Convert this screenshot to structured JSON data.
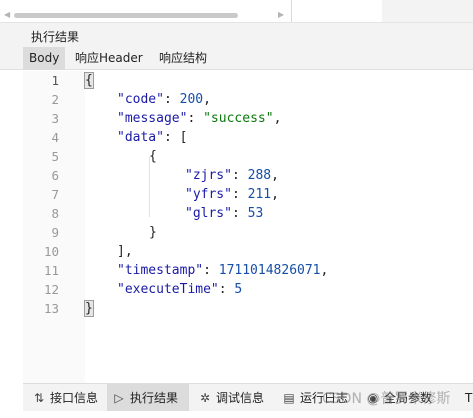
{
  "section": {
    "title": "执行结果"
  },
  "tabs": [
    {
      "label": "Body"
    },
    {
      "label": "响应Header"
    },
    {
      "label": "响应结构"
    }
  ],
  "editor": {
    "line_numbers": [
      "1",
      "2",
      "3",
      "4",
      "5",
      "6",
      "7",
      "8",
      "9",
      "10",
      "11",
      "12",
      "13"
    ],
    "lines": {
      "l1": {
        "open": "{"
      },
      "l2": {
        "key": "\"code\"",
        "sep": ": ",
        "val": "200",
        "end": ","
      },
      "l3": {
        "key": "\"message\"",
        "sep": ": ",
        "val": "\"success\"",
        "end": ","
      },
      "l4": {
        "key": "\"data\"",
        "sep": ": ",
        "val": "["
      },
      "l5": {
        "text": "{"
      },
      "l6": {
        "key": "\"zjrs\"",
        "sep": ": ",
        "val": "288",
        "end": ","
      },
      "l7": {
        "key": "\"yfrs\"",
        "sep": ": ",
        "val": "211",
        "end": ","
      },
      "l8": {
        "key": "\"glrs\"",
        "sep": ": ",
        "val": "53"
      },
      "l9": {
        "text": "}"
      },
      "l10": {
        "text": "],"
      },
      "l11": {
        "key": "\"timestamp\"",
        "sep": ": ",
        "val": "1711014826071",
        "end": ","
      },
      "l12": {
        "key": "\"executeTime\"",
        "sep": ": ",
        "val": "5"
      },
      "l13": {
        "close": "}"
      }
    }
  },
  "bottom_tabs": [
    {
      "label": "接口信息",
      "icon": "api-info-icon"
    },
    {
      "label": "执行结果",
      "icon": "play-icon"
    },
    {
      "label": "调试信息",
      "icon": "debug-icon"
    },
    {
      "label": "运行日志",
      "icon": "log-icon"
    },
    {
      "label": "全局参数",
      "icon": "global-params-icon"
    },
    {
      "label": "T"
    }
  ],
  "watermark": "CSDN @普罗米修斯"
}
